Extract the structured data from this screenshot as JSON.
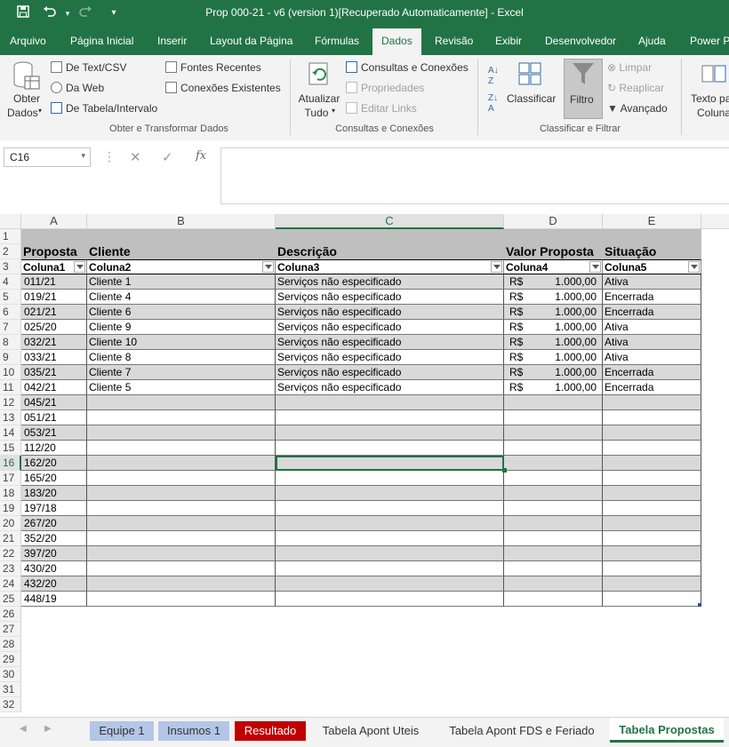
{
  "window": {
    "title": "Prop 000-21 - v6 (version 1)[Recuperado Automaticamente]  -  Excel"
  },
  "qat": {
    "save_icon": "save-icon",
    "undo_icon": "undo-icon",
    "redo_icon": "redo-icon",
    "customize_icon": "chevron-down-icon"
  },
  "ribbon_tabs": [
    "Arquivo",
    "Página Inicial",
    "Inserir",
    "Layout da Página",
    "Fórmulas",
    "Dados",
    "Revisão",
    "Exibir",
    "Desenvolvedor",
    "Ajuda",
    "Power P"
  ],
  "active_tab": "Dados",
  "ribbon": {
    "get_data": {
      "line1": "Obter",
      "line2": "Dados"
    },
    "from_text": "De Text/CSV",
    "from_web": "Da Web",
    "from_table": "De Tabela/Intervalo",
    "recent_sources": "Fontes Recentes",
    "existing_connections": "Conexões Existentes",
    "group_get": "Obter e Transformar Dados",
    "refresh_all": {
      "line1": "Atualizar",
      "line2": "Tudo"
    },
    "queries_connections": "Consultas e Conexões",
    "properties": "Propriedades",
    "edit_links": "Editar Links",
    "group_queries": "Consultas e Conexões",
    "sort": "Classificar",
    "filter": "Filtro",
    "clear": "Limpar",
    "reapply": "Reaplicar",
    "advanced": "Avançado",
    "group_sort": "Classificar e Filtrar",
    "text_to_columns": {
      "line1": "Texto pa",
      "line2": "Coluna"
    }
  },
  "formula_bar": {
    "name_box": "C16",
    "fx": "fx",
    "formula": ""
  },
  "columns": [
    "A",
    "B",
    "C",
    "D",
    "E"
  ],
  "selected_column": "C",
  "selected_row": 16,
  "table": {
    "header_row": [
      "Proposta",
      "Cliente",
      "Descrição",
      "Valor Proposta",
      "Situação"
    ],
    "column_names": [
      "Coluna1",
      "Coluna2",
      "Coluna3",
      "Coluna4",
      "Coluna5"
    ],
    "rows": [
      [
        "011/21",
        "Cliente 1",
        "Serviços não especificado",
        "R$",
        "1.000,00",
        "Ativa"
      ],
      [
        "019/21",
        "Cliente 4",
        "Serviços não especificado",
        "R$",
        "1.000,00",
        "Encerrada"
      ],
      [
        "021/21",
        "Cliente 6",
        "Serviços não especificado",
        "R$",
        "1.000,00",
        "Encerrada"
      ],
      [
        "025/20",
        "Cliente 9",
        "Serviços não especificado",
        "R$",
        "1.000,00",
        "Ativa"
      ],
      [
        "032/21",
        "Cliente 10",
        "Serviços não especificado",
        "R$",
        "1.000,00",
        "Ativa"
      ],
      [
        "033/21",
        "Cliente 8",
        "Serviços não especificado",
        "R$",
        "1.000,00",
        "Ativa"
      ],
      [
        "035/21",
        "Cliente 7",
        "Serviços não especificado",
        "R$",
        "1.000,00",
        "Encerrada"
      ],
      [
        "042/21",
        "Cliente 5",
        "Serviços não especificado",
        "R$",
        "1.000,00",
        "Encerrada"
      ],
      [
        "045/21",
        "",
        "",
        "",
        "",
        ""
      ],
      [
        "051/21",
        "",
        "",
        "",
        "",
        ""
      ],
      [
        "053/21",
        "",
        "",
        "",
        "",
        ""
      ],
      [
        "112/20",
        "",
        "",
        "",
        "",
        ""
      ],
      [
        "162/20",
        "",
        "",
        "",
        "",
        ""
      ],
      [
        "165/20",
        "",
        "",
        "",
        "",
        ""
      ],
      [
        "183/20",
        "",
        "",
        "",
        "",
        ""
      ],
      [
        "197/18",
        "",
        "",
        "",
        "",
        ""
      ],
      [
        "267/20",
        "",
        "",
        "",
        "",
        ""
      ],
      [
        "352/20",
        "",
        "",
        "",
        "",
        ""
      ],
      [
        "397/20",
        "",
        "",
        "",
        "",
        ""
      ],
      [
        "430/20",
        "",
        "",
        "",
        "",
        ""
      ],
      [
        "432/20",
        "",
        "",
        "",
        "",
        ""
      ],
      [
        "448/19",
        "",
        "",
        "",
        "",
        ""
      ]
    ]
  },
  "row_numbers": [
    "1",
    "2",
    "3",
    "4",
    "5",
    "6",
    "7",
    "8",
    "9",
    "10",
    "11",
    "12",
    "13",
    "14",
    "15",
    "16",
    "17",
    "18",
    "19",
    "20",
    "21",
    "22",
    "23",
    "24",
    "25",
    "26",
    "27",
    "28",
    "29",
    "30",
    "31",
    "32"
  ],
  "sheet_tabs": [
    {
      "label": "Equipe 1",
      "color": "#b4c6e7"
    },
    {
      "label": "Insumos 1",
      "color": "#b4c6e7"
    },
    {
      "label": "Resultado",
      "color": "#c00000"
    },
    {
      "label": "Tabela Apont Uteis",
      "color": ""
    },
    {
      "label": "Tabela Apont FDS e Feriado",
      "color": ""
    },
    {
      "label": "Tabela Propostas",
      "color": ""
    }
  ],
  "active_sheet": "Tabela Propostas",
  "colors": {
    "excel_green": "#217346",
    "band_gray": "#d9d9d9",
    "header_gray": "#bfbfbf"
  }
}
